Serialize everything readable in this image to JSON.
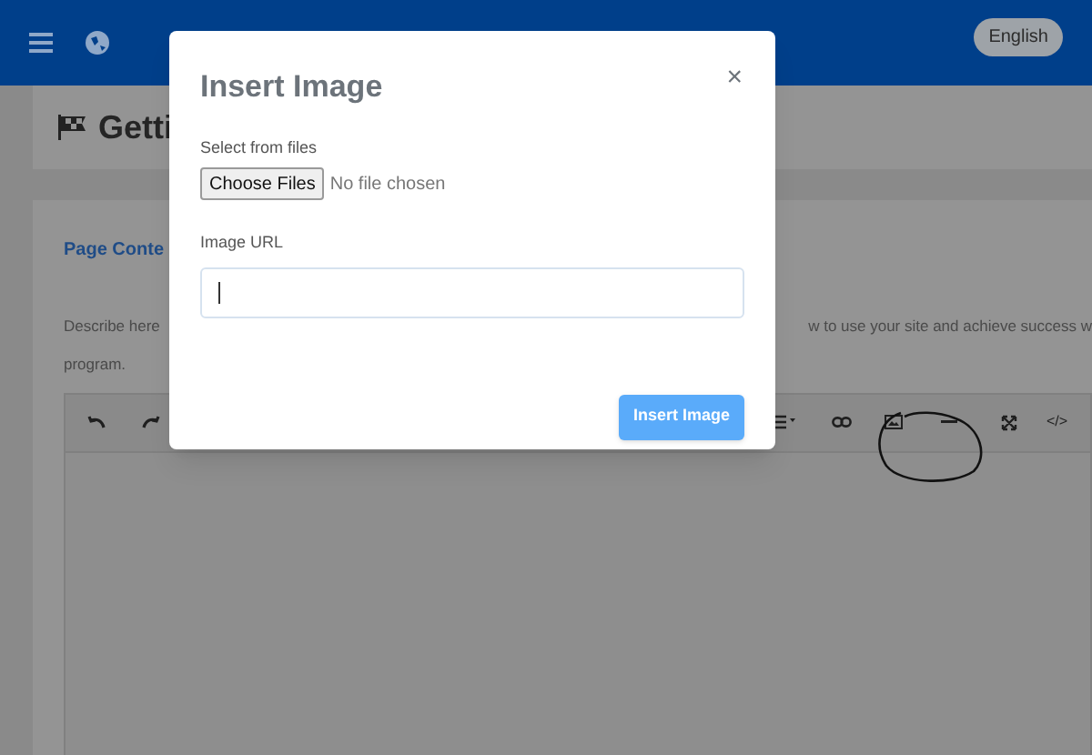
{
  "header": {
    "language": "English"
  },
  "page_title": "Getti",
  "section": {
    "title": "Page Conte",
    "description_left": "Describe here",
    "description_right": "w to use your site and achieve success w",
    "description_end": "program."
  },
  "editor": {
    "code_label": "</>"
  },
  "modal": {
    "title": "Insert Image",
    "close": "×",
    "file_label": "Select from files",
    "file_button": "Choose Files",
    "file_status": "No file chosen",
    "url_label": "Image URL",
    "submit": "Insert Image"
  }
}
